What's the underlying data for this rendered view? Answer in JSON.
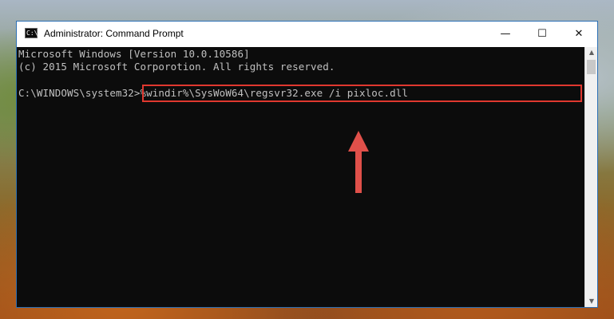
{
  "window": {
    "title": "Administrator: Command Prompt",
    "icon_text": "C:\\",
    "controls": {
      "minimize": "—",
      "maximize": "☐",
      "close": "✕"
    }
  },
  "console": {
    "lines": [
      "Microsoft Windows [Version 10.0.10586]",
      "(c) 2015 Microsoft Corporotion. All rights reserved."
    ],
    "prompt": "C:\\WINDOWS\\system32>",
    "command": "%windir%\\SysWoW64\\regsvr32.exe /i pixloc.dll"
  },
  "annotation": {
    "highlight_color": "#e0382f",
    "arrow_color": "#e0504a",
    "arrow_icon": "up-arrow-icon"
  },
  "scrollbar": {
    "up_icon": "▲",
    "down_icon": "▼"
  }
}
